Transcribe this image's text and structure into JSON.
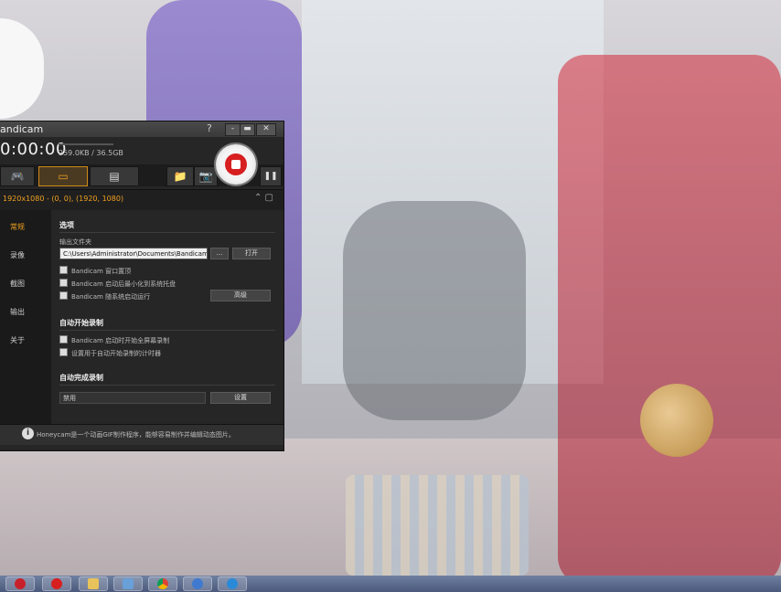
{
  "window": {
    "title": "andicam",
    "help": "?",
    "minimize": "-",
    "maximize": "▬",
    "close": "✕",
    "timer": "0:00:00",
    "size": "259.0KB / 36.5GB"
  },
  "modes": [
    {
      "name": "game",
      "icon": "gamepad-icon",
      "label": "🎮"
    },
    {
      "name": "screen",
      "icon": "rectangle-icon",
      "label": "▭"
    },
    {
      "name": "device",
      "icon": "hdmi-icon",
      "label": "▤"
    }
  ],
  "toolbar": {
    "folder": "📁",
    "camera": "📷",
    "pause": "❚❚"
  },
  "resolution": {
    "text": "1920x1080 - (0, 0), (1920, 1080)",
    "ctl": "⌃ ▢"
  },
  "sidebar": [
    {
      "label": "常规",
      "active": true
    },
    {
      "label": "录像",
      "active": false
    },
    {
      "label": "截图",
      "active": false
    },
    {
      "label": "输出",
      "active": false
    },
    {
      "label": "关于",
      "active": false
    }
  ],
  "options": {
    "title": "选项",
    "output_label": "输出文件夹",
    "output_path": "C:\\Users\\Administrator\\Documents\\Bandicam",
    "browse": "...",
    "open": "打开",
    "checks": [
      "Bandicam 窗口置顶",
      "Bandicam 启动后最小化到系统托盘",
      "Bandicam 随系统启动运行"
    ],
    "advanced": "高级"
  },
  "autostart": {
    "title": "自动开始录制",
    "checks": [
      "Bandicam 启动时开始全屏幕录制",
      "设置用于自动开始录制的计时器"
    ]
  },
  "autocomplete": {
    "title": "自动完成录制",
    "value": "禁用",
    "settings": "设置"
  },
  "footer": {
    "info": "i",
    "tip": "Honeycam是一个动画GIF制作程序，能够容易制作并编辑动态图片。"
  },
  "colors": {
    "accent": "#f0a020",
    "record": "#d71f1f"
  }
}
